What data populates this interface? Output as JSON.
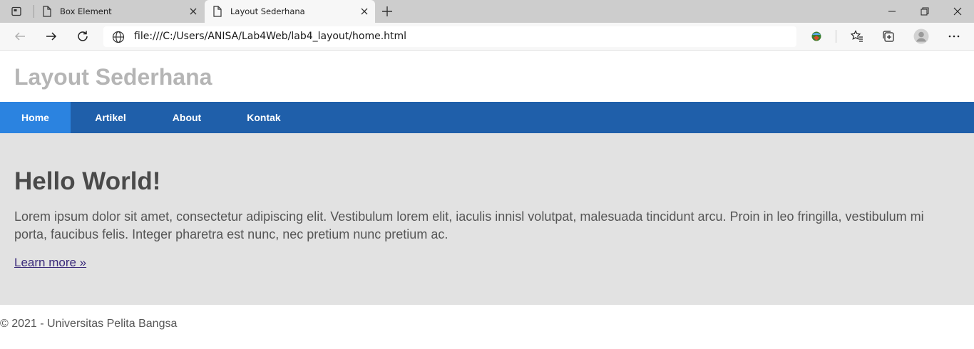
{
  "browser": {
    "tabs": [
      {
        "title": "Box Element",
        "active": false
      },
      {
        "title": "Layout Sederhana",
        "active": true
      }
    ],
    "address": {
      "url": "file:///C:/Users/ANISA/Lab4Web/lab4_layout/home.html"
    },
    "icons": {
      "tab_actions": "tab-actions-icon",
      "page": "page-icon",
      "close": "close-icon",
      "new_tab": "plus-icon",
      "minimize": "minimize-icon",
      "restore": "restore-icon",
      "window_close": "close-icon",
      "back": "arrow-left-icon",
      "forward": "arrow-right-icon",
      "refresh": "refresh-icon",
      "site_info": "globe-icon",
      "extension": "extension-icon",
      "favorites": "favorites-icon",
      "collections": "collections-icon",
      "profile": "profile-avatar-icon",
      "menu": "more-icon"
    }
  },
  "page": {
    "header": {
      "title": "Layout Sederhana"
    },
    "nav": {
      "items": [
        {
          "label": "Home",
          "active": true
        },
        {
          "label": "Artikel",
          "active": false
        },
        {
          "label": "About",
          "active": false
        },
        {
          "label": "Kontak",
          "active": false
        }
      ]
    },
    "hero": {
      "heading": "Hello World!",
      "text": "Lorem ipsum dolor sit amet, consectetur adipiscing elit. Vestibulum lorem elit, iaculis innisl volutpat, malesuada tincidunt arcu. Proin in leo fringilla, vestibulum mi porta, faucibus felis. Integer pharetra est nunc, nec pretium nunc pretium ac.",
      "link_label": "Learn more »"
    },
    "footer": {
      "text": "© 2021 - Universitas Pelita Bangsa"
    }
  },
  "colors": {
    "nav_background": "#1f5faa",
    "nav_active": "#2b83e0",
    "hero_background": "#e2e2e2",
    "title_text": "#b5b5b5",
    "link": "#3a2a7a"
  }
}
